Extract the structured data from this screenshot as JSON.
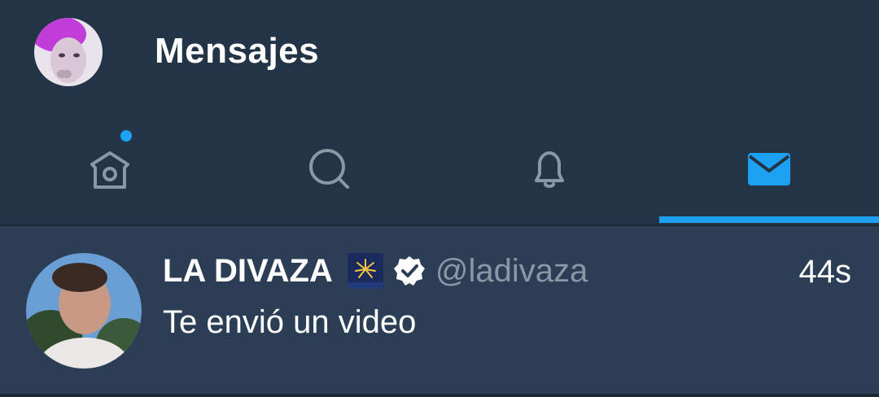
{
  "header": {
    "title": "Mensajes",
    "avatar_icon": "profile-avatar"
  },
  "tabs": [
    {
      "name": "home",
      "icon": "home-icon",
      "has_notification_dot": true,
      "active": false
    },
    {
      "name": "search",
      "icon": "search-icon",
      "active": false
    },
    {
      "name": "notifications",
      "icon": "bell-icon",
      "active": false
    },
    {
      "name": "messages",
      "icon": "mail-icon",
      "active": true
    }
  ],
  "colors": {
    "accent": "#1da1f2",
    "background": "#243447",
    "row_background": "#2c3e55",
    "muted": "#8899a6"
  },
  "conversations": [
    {
      "name": "LA DIVAZA",
      "emoji_icon": "fireworks-emoji",
      "verified": true,
      "handle": "@ladivaza",
      "time": "44s",
      "preview": "Te envió un video"
    }
  ]
}
